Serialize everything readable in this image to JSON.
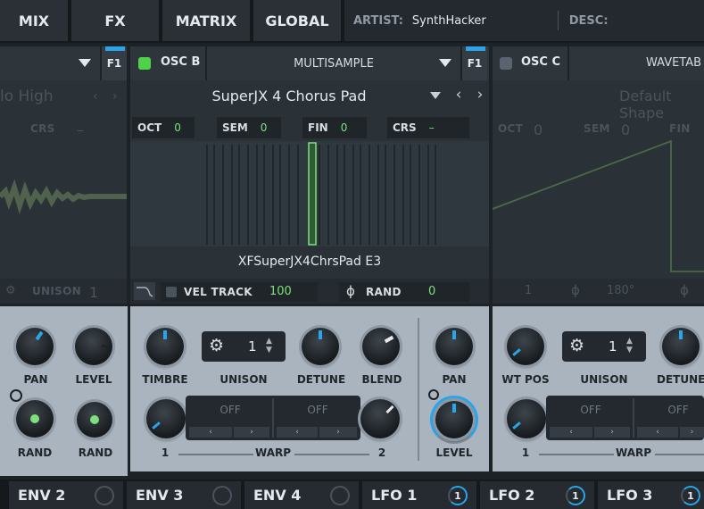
{
  "nav": {
    "tabs": [
      "MIX",
      "FX",
      "MATRIX",
      "GLOBAL"
    ]
  },
  "info": {
    "artist_label": "ARTIST:",
    "artist_value": "SynthHacker",
    "desc_label": "DESC:"
  },
  "osc_a": {
    "filter_badge": "F1",
    "preset_ghost": "lo High",
    "crs_label": "CRS",
    "crs_value": "–",
    "unison_label": "UNISON",
    "unison_value": "1",
    "knobs": {
      "pan": "PAN",
      "level": "LEVEL",
      "rand1": "RAND",
      "rand2": "RAND"
    }
  },
  "osc_b": {
    "title": "OSC B",
    "type": "MULTISAMPLE",
    "filter_badge": "F1",
    "preset": "SuperJX 4 Chorus Pad",
    "params": [
      {
        "label": "OCT",
        "value": "0"
      },
      {
        "label": "SEM",
        "value": "0"
      },
      {
        "label": "FIN",
        "value": "0"
      },
      {
        "label": "CRS",
        "value": "–"
      }
    ],
    "sample_name": "XFSuperJX4ChrsPad E3",
    "vel_track_label": "VEL TRACK",
    "vel_track_value": "100",
    "rand_label": "RAND",
    "rand_value": "0",
    "knobs": {
      "timbre": "TIMBRE",
      "unison": "UNISON",
      "unison_value": "1",
      "detune": "DETUNE",
      "blend": "BLEND",
      "pan": "PAN",
      "level": "LEVEL"
    },
    "warp": {
      "label": "WARP",
      "slot1": "OFF",
      "slot2": "OFF",
      "left": "1",
      "right": "2"
    }
  },
  "osc_c": {
    "title": "OSC C",
    "type": "WAVETAB",
    "preset_ghost": "Default Shape",
    "params": [
      {
        "label": "OCT",
        "value": "0"
      },
      {
        "label": "SEM",
        "value": "0"
      },
      {
        "label": "FIN",
        "value": ""
      }
    ],
    "bottom_value": "1",
    "phase_value": "180°",
    "knobs": {
      "wtpos": "WT POS",
      "unison": "UNISON",
      "unison_value": "1",
      "detune": "DETUNE"
    },
    "warp": {
      "label": "WARP",
      "slot1": "OFF",
      "slot2": "OFF",
      "left": "1"
    }
  },
  "bottom_tabs": [
    {
      "label": "ENV 2",
      "badge": ""
    },
    {
      "label": "ENV 3",
      "badge": ""
    },
    {
      "label": "ENV 4",
      "badge": ""
    },
    {
      "label": "LFO 1",
      "badge": "1"
    },
    {
      "label": "LFO 2",
      "badge": "1"
    },
    {
      "label": "LFO 3",
      "badge": "1"
    }
  ],
  "colors": {
    "accent_blue": "#2ba5ea",
    "green": "#7ee07a",
    "panel": "#a9b4bf"
  }
}
